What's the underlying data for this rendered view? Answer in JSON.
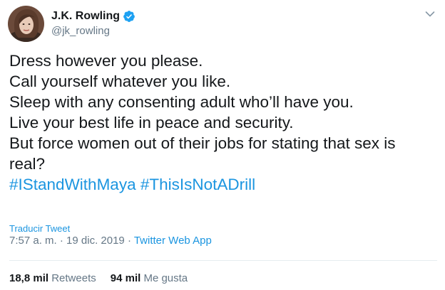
{
  "author": {
    "display_name": "J.K. Rowling",
    "handle": "@jk_rowling",
    "verified": true
  },
  "tweet": {
    "lines": [
      "Dress however you please.",
      "Call yourself whatever you like.",
      "Sleep with any consenting adult who’ll have you.",
      "Live your best life in peace and security.",
      "But force women out of their jobs for stating that sex is",
      "real?"
    ],
    "hashtags": [
      "#IStandWithMaya",
      "#ThisIsNotADrill"
    ]
  },
  "translate_label": "Traducir Tweet",
  "meta": {
    "time": "7:57 a. m.",
    "separator": " · ",
    "date": "19 dic. 2019",
    "source": "Twitter Web App"
  },
  "stats": {
    "retweets_count": "18,8 mil",
    "retweets_label": "Retweets",
    "likes_count": "94 mil",
    "likes_label": "Me gusta"
  },
  "colors": {
    "link": "#1b95e0",
    "secondary_text": "#657786",
    "primary_text": "#14171a",
    "verified_badge": "#1da1f2"
  },
  "icons": {
    "verified": "verified-badge-icon",
    "caret": "chevron-down-icon"
  }
}
